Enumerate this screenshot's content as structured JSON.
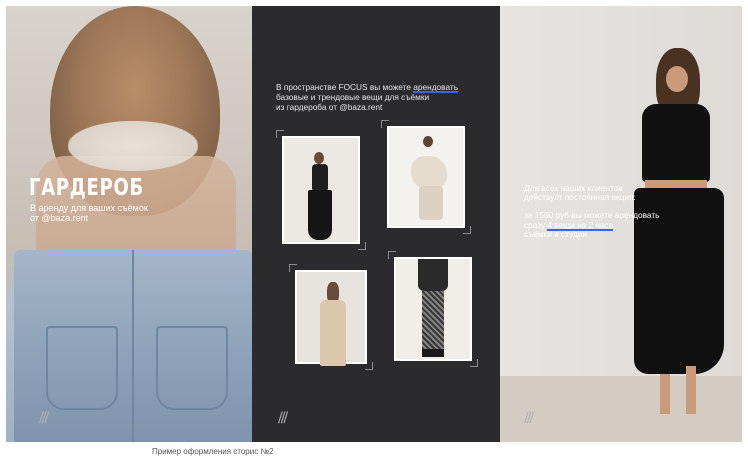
{
  "panel1": {
    "title": "ГАРДЕРОБ",
    "subtitle_line1": "В аренду для ваших съёмок",
    "subtitle_line2": "от @baza.rent",
    "decor": "///"
  },
  "panel2": {
    "intro_line1_before": "В пространстве FOCUS вы можете ",
    "intro_line1_highlight": "арендовать",
    "intro_line2": "базовые и трендовые вещи для съёмки",
    "intro_line3": "из гардероба от @baza.rent",
    "decor": "///"
  },
  "panel3": {
    "line1": "Для всех наших клиентов",
    "line2": "действует постоянная акция:",
    "line3": "за 1500 руб вы можете арендовать",
    "line4_before": "сразу ",
    "line4_highlight": "4 вещи на 2 часа",
    "line5": "съёмки в студии",
    "decor": "///"
  },
  "caption": "Пример оформления сторис №2",
  "colors": {
    "accent": "#3b63e3",
    "dark_panel": "#2b2a2d"
  }
}
